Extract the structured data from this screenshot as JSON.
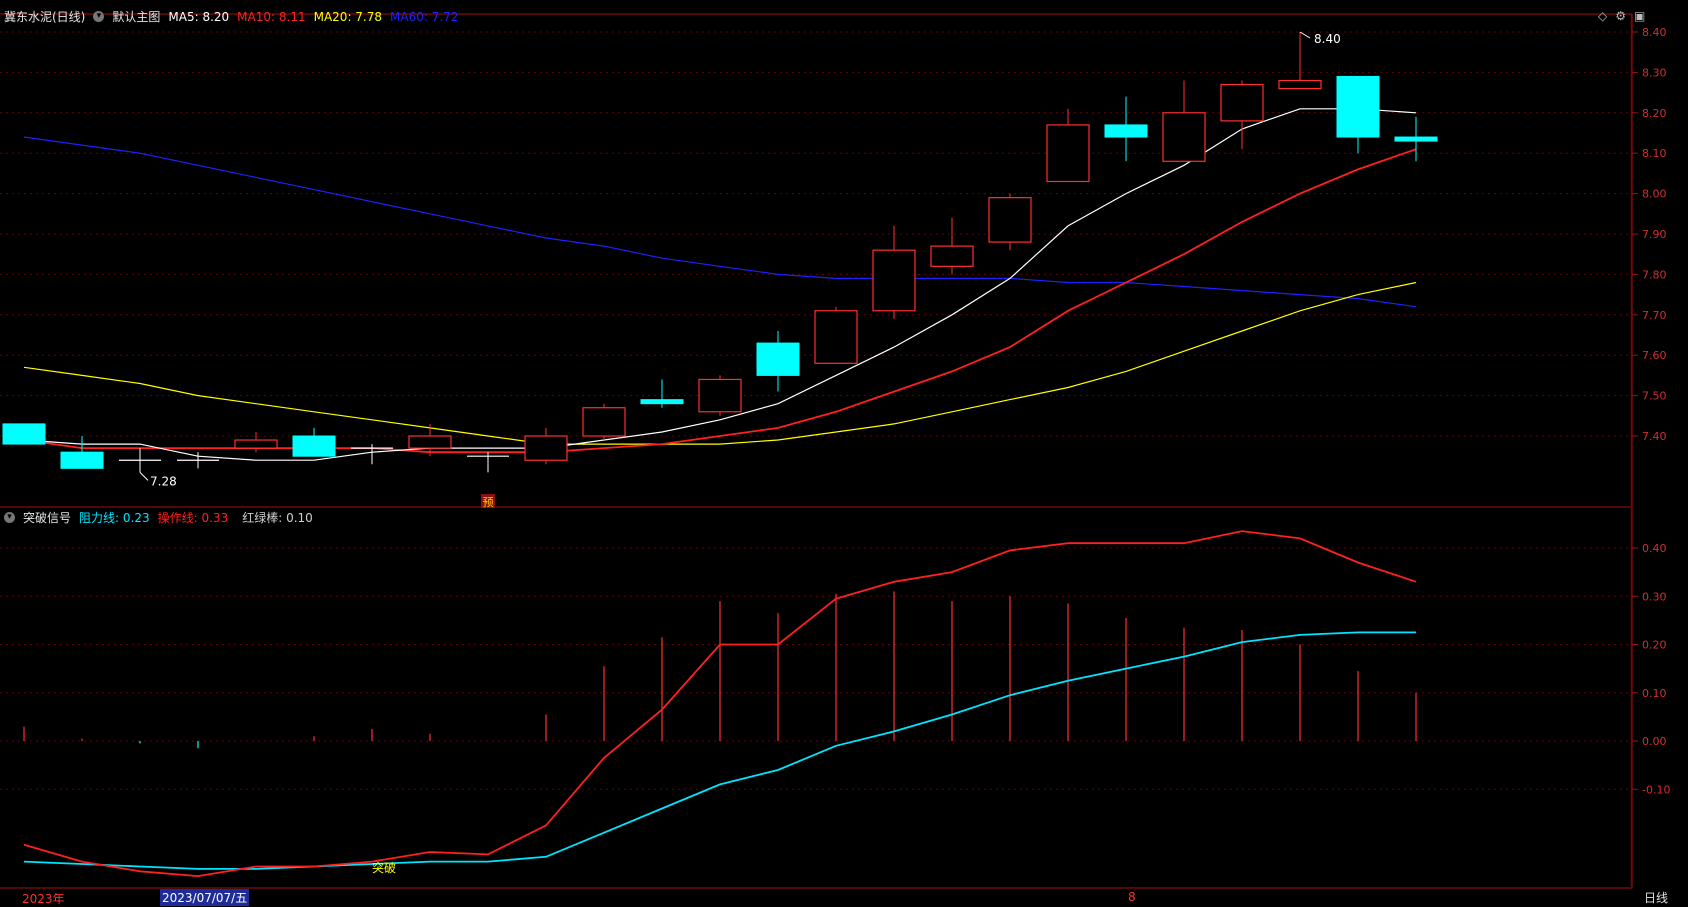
{
  "main_panel": {
    "stock_name": "冀东水泥(日线)",
    "chart_label": "默认主图",
    "ma": [
      {
        "label": "MA5",
        "value": "8.20",
        "color": "#ffffff"
      },
      {
        "label": "MA10",
        "value": "8.11",
        "color": "#ff2020"
      },
      {
        "label": "MA20",
        "value": "7.78",
        "color": "#ffff00"
      },
      {
        "label": "MA60",
        "value": "7.72",
        "color": "#2020ff"
      }
    ],
    "y_ticks": [
      "8.40",
      "8.30",
      "8.20",
      "8.10",
      "8.00",
      "7.90",
      "7.80",
      "7.70",
      "7.60",
      "7.50",
      "7.40"
    ],
    "high_marker": "8.40",
    "low_marker": "7.28",
    "signal_badge": "预"
  },
  "indicator_panel": {
    "name": "突破信号",
    "lines": [
      {
        "label": "阻力线",
        "value": "0.23",
        "color": "#00e5ff"
      },
      {
        "label": "操作线",
        "value": "0.33",
        "color": "#ff2020"
      },
      {
        "label": "红绿棒",
        "value": "0.10",
        "color": "#cfcfcf"
      }
    ],
    "y_ticks": [
      "0.40",
      "0.30",
      "0.20",
      "0.10",
      "0.00",
      "-0.10"
    ],
    "annotation": "突破"
  },
  "bottom_bar": {
    "year_label": "2023年",
    "cursor_date": "2023/07/07/五",
    "month_label": "8",
    "period_button": "日线"
  },
  "chart_data": {
    "type": "candlestick",
    "colors": {
      "up": "#ff3030",
      "down": "#00ffff",
      "ma5": "#ffffff",
      "ma10": "#ff2020",
      "ma20": "#ffff00",
      "ma60": "#2020ff",
      "resistance": "#00e5ff",
      "operation": "#ff2020"
    },
    "price_range": [
      7.28,
      8.44
    ],
    "candles": [
      {
        "o": 7.43,
        "h": 7.43,
        "l": 7.38,
        "c": 7.38
      },
      {
        "o": 7.36,
        "h": 7.4,
        "l": 7.32,
        "c": 7.32
      },
      {
        "o": 7.34,
        "h": 7.37,
        "l": 7.31,
        "c": 7.34
      },
      {
        "o": 7.34,
        "h": 7.36,
        "l": 7.32,
        "c": 7.34
      },
      {
        "o": 7.37,
        "h": 7.41,
        "l": 7.36,
        "c": 7.39
      },
      {
        "o": 7.4,
        "h": 7.42,
        "l": 7.35,
        "c": 7.35
      },
      {
        "o": 7.37,
        "h": 7.38,
        "l": 7.33,
        "c": 7.37
      },
      {
        "o": 7.37,
        "h": 7.43,
        "l": 7.35,
        "c": 7.4
      },
      {
        "o": 7.35,
        "h": 7.36,
        "l": 7.31,
        "c": 7.35
      },
      {
        "o": 7.34,
        "h": 7.42,
        "l": 7.33,
        "c": 7.4
      },
      {
        "o": 7.4,
        "h": 7.48,
        "l": 7.39,
        "c": 7.47
      },
      {
        "o": 7.49,
        "h": 7.54,
        "l": 7.47,
        "c": 7.48
      },
      {
        "o": 7.46,
        "h": 7.55,
        "l": 7.45,
        "c": 7.54
      },
      {
        "o": 7.63,
        "h": 7.66,
        "l": 7.51,
        "c": 7.55
      },
      {
        "o": 7.58,
        "h": 7.72,
        "l": 7.58,
        "c": 7.71
      },
      {
        "o": 7.71,
        "h": 7.92,
        "l": 7.69,
        "c": 7.86
      },
      {
        "o": 7.82,
        "h": 7.94,
        "l": 7.8,
        "c": 7.87
      },
      {
        "o": 7.88,
        "h": 8.0,
        "l": 7.86,
        "c": 7.99
      },
      {
        "o": 8.03,
        "h": 8.21,
        "l": 8.03,
        "c": 8.17
      },
      {
        "o": 8.17,
        "h": 8.24,
        "l": 8.08,
        "c": 8.14
      },
      {
        "o": 8.08,
        "h": 8.28,
        "l": 8.08,
        "c": 8.2
      },
      {
        "o": 8.18,
        "h": 8.28,
        "l": 8.11,
        "c": 8.27
      },
      {
        "o": 8.26,
        "h": 8.4,
        "l": 8.26,
        "c": 8.28
      },
      {
        "o": 8.29,
        "h": 8.29,
        "l": 8.1,
        "c": 8.14
      },
      {
        "o": 8.14,
        "h": 8.19,
        "l": 8.08,
        "c": 8.13
      }
    ],
    "ma5": [
      7.39,
      7.38,
      7.38,
      7.35,
      7.34,
      7.34,
      7.36,
      7.37,
      7.37,
      7.37,
      7.39,
      7.41,
      7.44,
      7.48,
      7.55,
      7.62,
      7.7,
      7.79,
      7.92,
      8.0,
      8.07,
      8.16,
      8.21,
      8.21,
      8.2
    ],
    "ma10": [
      7.39,
      7.37,
      7.37,
      7.37,
      7.37,
      7.37,
      7.37,
      7.36,
      7.36,
      7.36,
      7.37,
      7.38,
      7.4,
      7.42,
      7.46,
      7.51,
      7.56,
      7.62,
      7.71,
      7.78,
      7.85,
      7.93,
      8.0,
      8.06,
      8.11
    ],
    "ma20": [
      7.57,
      7.55,
      7.53,
      7.5,
      7.48,
      7.46,
      7.44,
      7.42,
      7.4,
      7.38,
      7.38,
      7.38,
      7.38,
      7.39,
      7.41,
      7.43,
      7.46,
      7.49,
      7.52,
      7.56,
      7.61,
      7.66,
      7.71,
      7.75,
      7.78
    ],
    "ma60": [
      8.14,
      8.12,
      8.1,
      8.07,
      8.04,
      8.01,
      7.98,
      7.95,
      7.92,
      7.89,
      7.87,
      7.84,
      7.82,
      7.8,
      7.79,
      7.79,
      7.79,
      7.79,
      7.78,
      7.78,
      7.77,
      7.76,
      7.75,
      7.74,
      7.72
    ],
    "indicator_range": [
      -0.29,
      0.47
    ],
    "resistance": [
      -0.25,
      -0.255,
      -0.26,
      -0.265,
      -0.265,
      -0.26,
      -0.255,
      -0.25,
      -0.25,
      -0.24,
      -0.19,
      -0.14,
      -0.09,
      -0.06,
      -0.01,
      0.02,
      0.055,
      0.095,
      0.125,
      0.15,
      0.175,
      0.205,
      0.22,
      0.225,
      0.225
    ],
    "operation": [
      -0.215,
      -0.25,
      -0.27,
      -0.28,
      -0.26,
      -0.26,
      -0.25,
      -0.23,
      -0.235,
      -0.175,
      -0.035,
      0.065,
      0.2,
      0.2,
      0.295,
      0.33,
      0.35,
      0.395,
      0.41,
      0.41,
      0.41,
      0.435,
      0.42,
      0.37,
      0.33
    ],
    "bars": [
      0.03,
      0.005,
      -0.005,
      -0.015,
      0.0,
      0.01,
      0.025,
      0.015,
      0.0,
      0.055,
      0.155,
      0.215,
      0.29,
      0.265,
      0.305,
      0.31,
      0.29,
      0.3,
      0.285,
      0.255,
      0.235,
      0.23,
      0.2,
      0.145,
      0.1
    ]
  }
}
